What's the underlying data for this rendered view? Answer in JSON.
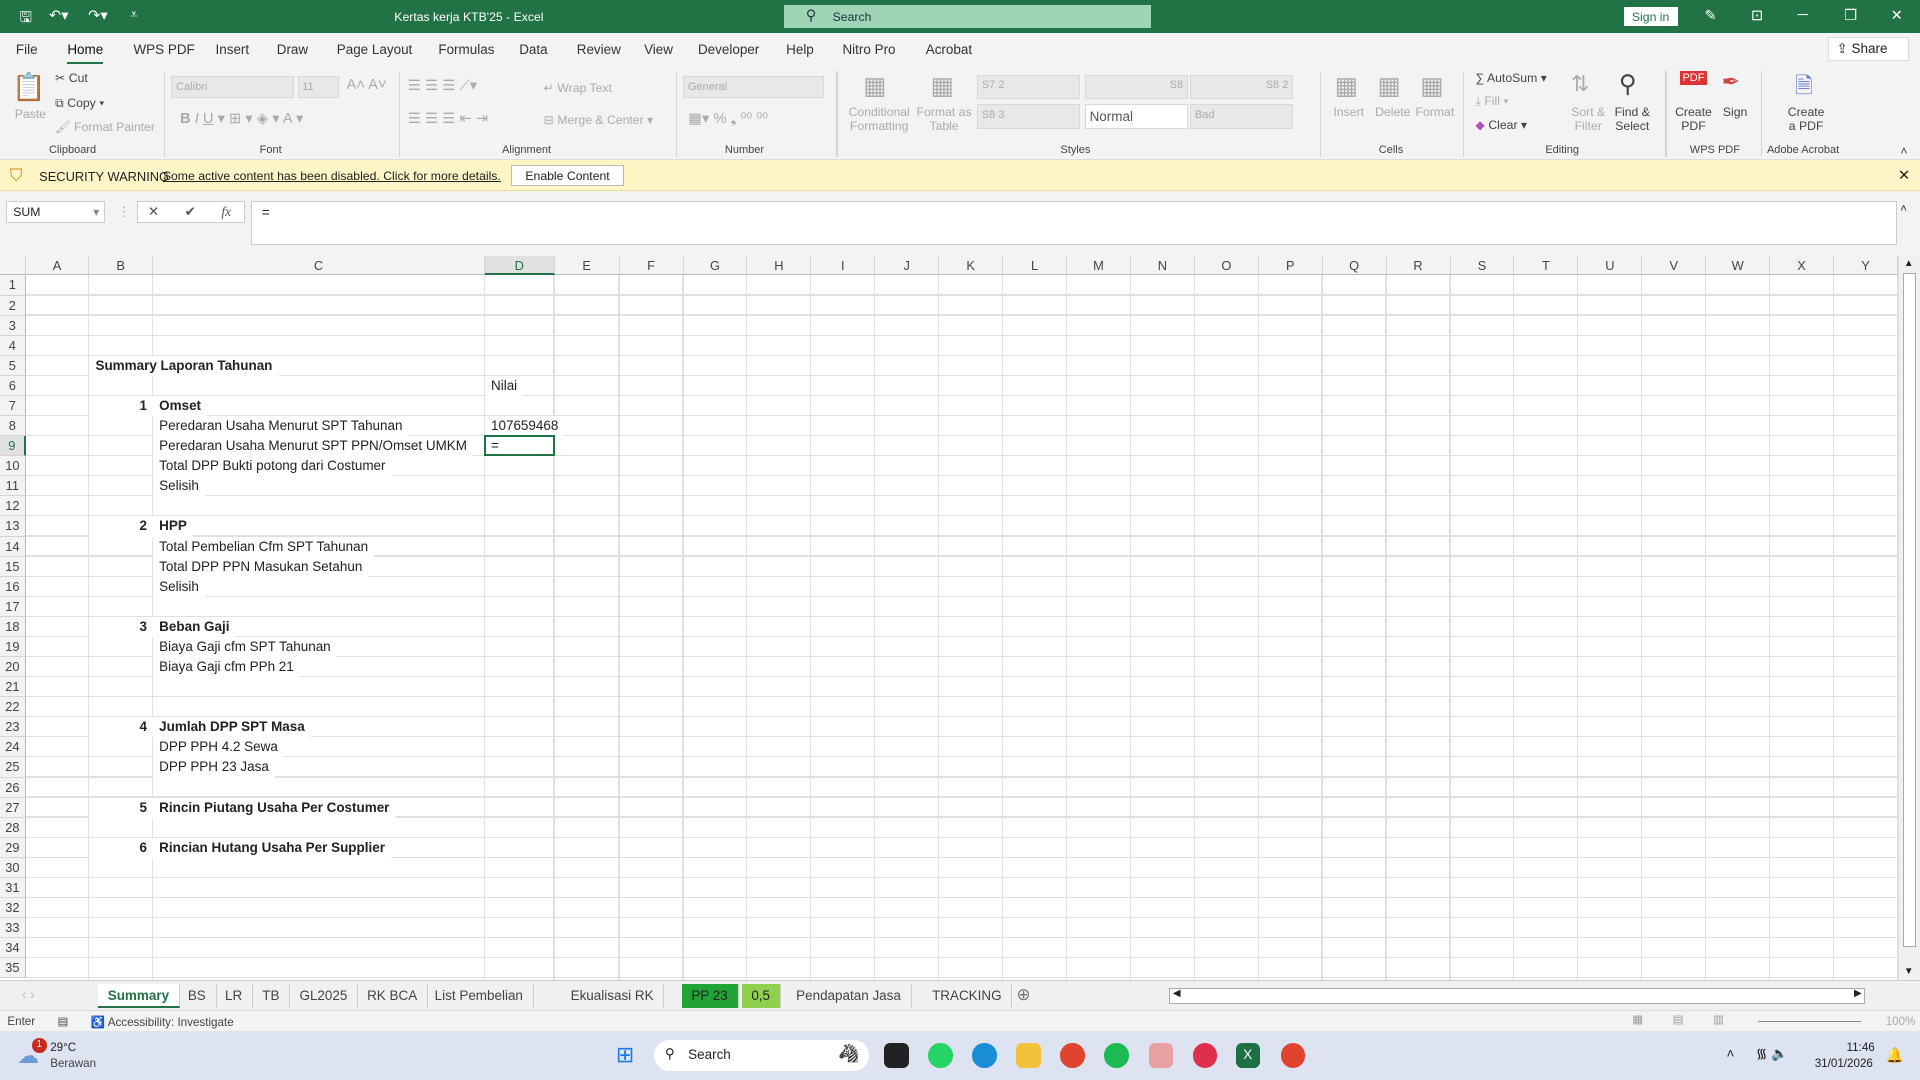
{
  "titlebar": {
    "title": "Kertas kerja KTB'25  -  Excel",
    "search_placeholder": "Search",
    "sign_in": "Sign in"
  },
  "menu": {
    "tabs": [
      "File",
      "Home",
      "WPS PDF",
      "Insert",
      "Draw",
      "Page Layout",
      "Formulas",
      "Data",
      "Review",
      "View",
      "Developer",
      "Help",
      "Nitro Pro",
      "Acrobat"
    ],
    "active": "Home",
    "share": "Share"
  },
  "ribbon": {
    "clipboard": {
      "paste": "Paste",
      "cut": "Cut",
      "copy": "Copy",
      "format_painter": "Format Painter",
      "group": "Clipboard"
    },
    "font": {
      "name": "Calibri",
      "size": "11",
      "group": "Font"
    },
    "alignment": {
      "wrap": "Wrap Text",
      "merge": "Merge & Center",
      "group": "Alignment"
    },
    "number": {
      "format": "General",
      "group": "Number"
    },
    "styles": {
      "conditional": "Conditional Formatting",
      "format_table": "Format as Table",
      "cells": [
        "S7 2",
        "S8",
        "S8 2",
        "S8 3",
        "Normal",
        "Bad"
      ],
      "group": "Styles"
    },
    "cells": {
      "insert": "Insert",
      "delete": "Delete",
      "format": "Format",
      "group": "Cells"
    },
    "editing": {
      "autosum": "AutoSum",
      "fill": "Fill",
      "clear": "Clear",
      "sort": "Sort & Filter",
      "find": "Find & Select",
      "group": "Editing"
    },
    "wps": {
      "create": "Create PDF",
      "sign": "Sign",
      "group": "WPS PDF"
    },
    "acrobat": {
      "create": "Create a PDF",
      "group": "Adobe Acrobat"
    }
  },
  "security": {
    "title": "SECURITY WARNING",
    "message": "Some active content has been disabled. Click for more details.",
    "button": "Enable Content"
  },
  "formula": {
    "name_box": "SUM",
    "value": "="
  },
  "columns": [
    "A",
    "B",
    "C",
    "D",
    "E",
    "F",
    "G",
    "H",
    "I",
    "J",
    "K",
    "L",
    "M",
    "N",
    "O",
    "P",
    "Q",
    "R",
    "S",
    "T",
    "U",
    "V",
    "W",
    "X",
    "Y"
  ],
  "rows": {
    "5": {
      "B": "Summary Laporan Tahunan",
      "bold": true
    },
    "6": {
      "D": "Nilai"
    },
    "7": {
      "B": "1",
      "C": "Omset",
      "bold": true
    },
    "8": {
      "C": "Peredaran Usaha Menurut SPT Tahunan",
      "D": "107659468"
    },
    "9": {
      "C": "Peredaran Usaha Menurut SPT PPN/Omset UMKM",
      "D": "="
    },
    "10": {
      "C": "Total DPP Bukti potong dari Costumer"
    },
    "11": {
      "C": "Selisih"
    },
    "13": {
      "B": "2",
      "C": "HPP",
      "bold": true
    },
    "14": {
      "C": "Total Pembelian Cfm SPT Tahunan"
    },
    "15": {
      "C": "Total DPP PPN Masukan Setahun"
    },
    "16": {
      "C": "Selisih"
    },
    "18": {
      "B": "3",
      "C": "Beban Gaji",
      "bold": true
    },
    "19": {
      "C": "Biaya Gaji cfm SPT Tahunan"
    },
    "20": {
      "C": "Biaya Gaji cfm PPh 21"
    },
    "23": {
      "B": "4",
      "C": "Jumlah DPP SPT Masa",
      "bold": true
    },
    "24": {
      "C": "DPP PPH 4.2 Sewa"
    },
    "25": {
      "C": "DPP PPH 23 Jasa"
    },
    "27": {
      "B": "5",
      "C": "Rincin Piutang Usaha Per Costumer",
      "bold": true
    },
    "29": {
      "B": "6",
      "C": "Rincian Hutang Usaha Per Supplier",
      "bold": true
    }
  },
  "sheet_tabs": [
    {
      "label": "Summary",
      "active": true
    },
    {
      "label": "BS"
    },
    {
      "label": "LR"
    },
    {
      "label": "TB"
    },
    {
      "label": "GL2025"
    },
    {
      "label": "RK BCA"
    },
    {
      "label": "List  Pembelian"
    },
    {
      "label": "Ekualisasi RK"
    },
    {
      "label": "PP 23",
      "color": "#21a336"
    },
    {
      "label": "0,5",
      "color": "#8fd14f"
    },
    {
      "label": "Pendapatan Jasa"
    },
    {
      "label": "TRACKING"
    }
  ],
  "status": {
    "mode": "Enter",
    "accessibility": "Accessibility: Investigate",
    "zoom": "100%"
  },
  "taskbar": {
    "weather_temp": "29°C",
    "weather_desc": "Berawan",
    "weather_badge": "1",
    "search": "Search",
    "time": "11:46",
    "date": "31/01/2026"
  }
}
